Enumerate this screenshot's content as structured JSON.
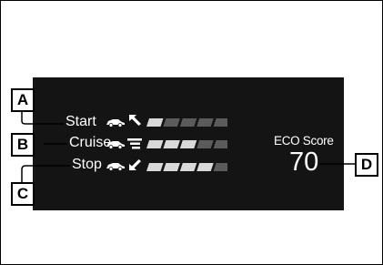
{
  "callouts": {
    "a": "A",
    "b": "B",
    "c": "C",
    "d": "D"
  },
  "rows": [
    {
      "label": "Start",
      "arrow": "up-left-arrow-icon",
      "filled_segments": 1,
      "total_segments": 5
    },
    {
      "label": "Cruise",
      "arrow": "level-arrow-icon",
      "filled_segments": 3,
      "total_segments": 5
    },
    {
      "label": "Stop",
      "arrow": "down-left-arrow-icon",
      "filled_segments": 4,
      "total_segments": 5
    }
  ],
  "eco": {
    "label": "ECO Score",
    "value": "70"
  },
  "colors": {
    "display_bg": "#141414",
    "segment_on": "#d9d9d9",
    "segment_off": "#5b5b5b",
    "text": "#ffffff"
  }
}
